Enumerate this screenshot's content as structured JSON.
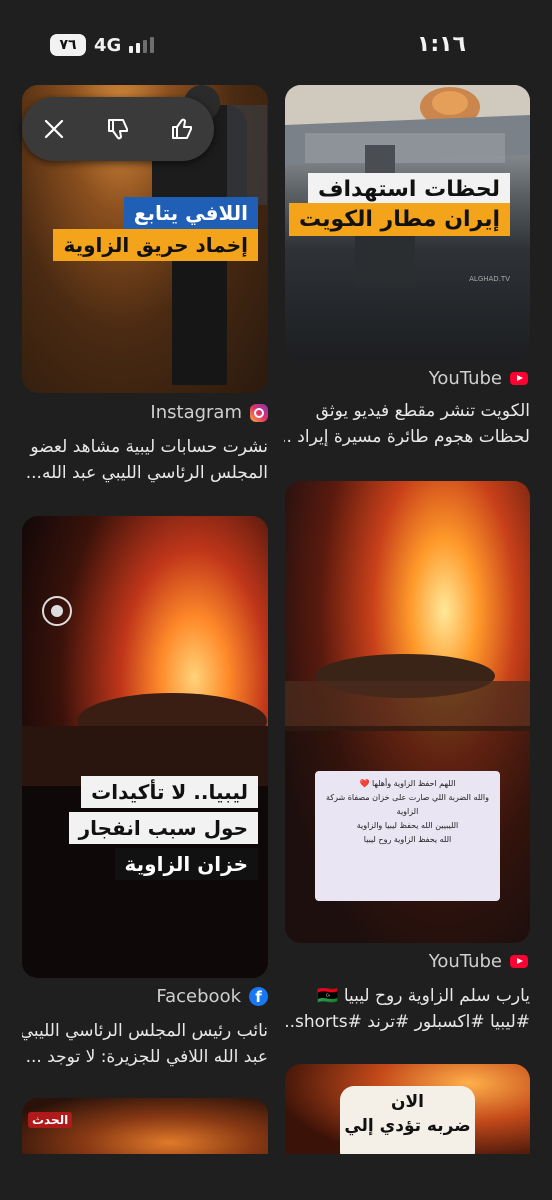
{
  "status_bar": {
    "battery": "٧٦",
    "network": "4G",
    "time": "١:١٦"
  },
  "feedback_bar": {
    "actions": [
      "close-icon",
      "thumbs-down-icon",
      "thumbs-up-icon"
    ]
  },
  "cards": [
    {
      "overlay_lines": [
        "لحظات استهداف",
        "إيران مطار الكويت"
      ],
      "watermark": "ALGHAD.TV",
      "source": "YouTube",
      "caption_lines": [
        "الكويت تنشر مقطع فيديو يوثق",
        "لحظات هجوم طائرة مسيرة إيراد ..."
      ]
    },
    {
      "overlay_lines": [
        "اللافي يتابع",
        "إخماد حريق الزاوية"
      ],
      "source": "Instagram",
      "caption_lines": [
        "نشرت حسابات ليبية مشاهد لعضو",
        "المجلس الرئاسي الليبي عبد الله..."
      ]
    },
    {
      "overlay_lines": [
        "اللهم احفظ الزاوية وأهلها ❤️",
        "والله الضربة اللي صارت على خزان مصفاة شركة الزاوية",
        "الليبيين الله يحفظ ليبيا والزاوية",
        "الله يحفظ الزاوية روح ليبيا"
      ],
      "source": "YouTube",
      "caption_lines": [
        "يارب سلم الزاوية روح ليبيا 🇱🇾",
        "#ليبيا #اكسبلور #ترند #shorts..."
      ]
    },
    {
      "overlay_lines": [
        "ليبيا.. لا تأكيدات",
        "حول سبب انفجار",
        "خزان الزاوية"
      ],
      "source": "Facebook",
      "caption_lines": [
        "نائب رئيس المجلس الرئاسي الليبي",
        "عبد الله اللافي للجزيرة: لا توجد ..."
      ]
    },
    {
      "overlay_lines": [
        "الان",
        "ضربه تؤدي إلي"
      ]
    },
    {
      "overlay_lines": [
        "الحدث"
      ]
    }
  ]
}
